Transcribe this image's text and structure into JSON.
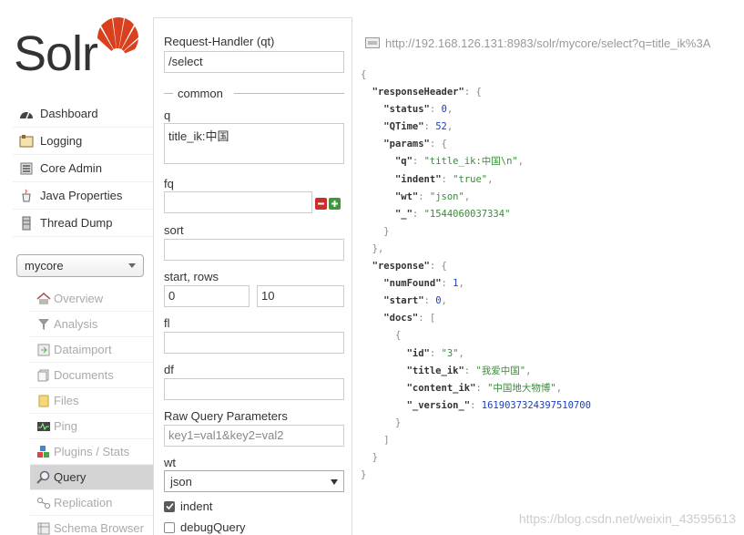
{
  "logo": {
    "text": "Solr"
  },
  "nav": [
    {
      "label": "Dashboard",
      "icon": "dashboard-icon",
      "name": "dashboard"
    },
    {
      "label": "Logging",
      "icon": "logging-icon",
      "name": "logging"
    },
    {
      "label": "Core Admin",
      "icon": "core-admin-icon",
      "name": "core-admin"
    },
    {
      "label": "Java Properties",
      "icon": "java-properties-icon",
      "name": "java-properties"
    },
    {
      "label": "Thread Dump",
      "icon": "thread-dump-icon",
      "name": "thread-dump"
    }
  ],
  "core_selector": {
    "value": "mycore"
  },
  "core_menu": [
    {
      "label": "Overview",
      "icon": "home-icon",
      "name": "overview"
    },
    {
      "label": "Analysis",
      "icon": "filter-icon",
      "name": "analysis"
    },
    {
      "label": "Dataimport",
      "icon": "dataimport-icon",
      "name": "dataimport"
    },
    {
      "label": "Documents",
      "icon": "documents-icon",
      "name": "documents"
    },
    {
      "label": "Files",
      "icon": "files-icon",
      "name": "files"
    },
    {
      "label": "Ping",
      "icon": "ping-icon",
      "name": "ping"
    },
    {
      "label": "Plugins / Stats",
      "icon": "plugins-icon",
      "name": "plugins-stats"
    },
    {
      "label": "Query",
      "icon": "query-icon",
      "name": "query",
      "active": true
    },
    {
      "label": "Replication",
      "icon": "replication-icon",
      "name": "replication"
    },
    {
      "label": "Schema Browser",
      "icon": "schema-icon",
      "name": "schema-browser"
    }
  ],
  "form": {
    "request_handler_label": "Request-Handler (qt)",
    "request_handler_value": "/select",
    "common_label": "common",
    "q_label": "q",
    "q_value": "title_ik:中国",
    "fq_label": "fq",
    "fq_value": "",
    "sort_label": "sort",
    "sort_value": "",
    "start_rows_label": "start, rows",
    "start_value": "0",
    "rows_value": "10",
    "fl_label": "fl",
    "fl_value": "",
    "df_label": "df",
    "df_value": "",
    "raw_label": "Raw Query Parameters",
    "raw_placeholder": "key1=val1&key2=val2",
    "wt_label": "wt",
    "wt_value": "json",
    "indent_label": "indent",
    "indent_checked": true,
    "debug_label": "debugQuery",
    "debug_checked": false
  },
  "result": {
    "url": "http://192.168.126.131:8983/solr/mycore/select?q=title_ik%3A",
    "responseHeader": {
      "status": "0",
      "QTime": "52",
      "params": {
        "q": "\"title_ik:中国\\n\"",
        "indent": "\"true\"",
        "wt": "\"json\"",
        "_": "\"1544060037334\""
      }
    },
    "response": {
      "numFound": "1",
      "start": "0",
      "doc": {
        "id": "\"3\"",
        "title_ik": "\"我爱中国\"",
        "content_ik": "\"中国地大物博\"",
        "_version_": "1619037324397510700"
      }
    }
  },
  "watermark": "https://blog.csdn.net/weixin_43595613",
  "colors": {
    "logo_red": "#d9411e",
    "active_bg": "#d4d4d4",
    "json_string": "#3a8b3a",
    "json_number": "#1a40c0"
  }
}
